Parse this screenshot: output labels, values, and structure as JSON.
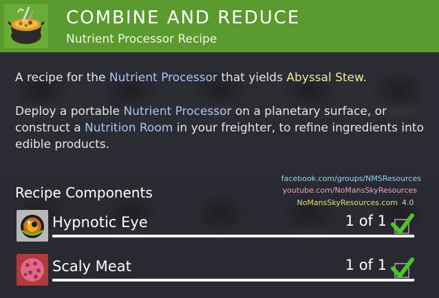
{
  "header": {
    "title": "COMBINE AND REDUCE",
    "subtitle": "Nutrient Processor Recipe"
  },
  "description": {
    "p1_a": "A recipe for the ",
    "p1_link": "Nutrient Processor",
    "p1_b": " that yields ",
    "p1_item": "Abyssal Stew",
    "p1_c": ".",
    "p2_a": "Deploy a portable ",
    "p2_link1": "Nutrient Processor",
    "p2_b": " on a planetary surface, or construct a ",
    "p2_link2": "Nutrition Room",
    "p2_c": " in your freighter, to refine ingredients into edible products."
  },
  "watermark": {
    "facebook": "facebook.com/groups/NMSResources",
    "youtube": "youtube.com/NoMansSkyResources",
    "site": "NoMansSkyResources.com",
    "version": "4.0"
  },
  "components_title": "Recipe Components",
  "components": [
    {
      "name": "Hypnotic Eye",
      "count": "1 of 1",
      "icon": "hypnotic-eye-icon"
    },
    {
      "name": "Scaly Meat",
      "count": "1 of 1",
      "icon": "scaly-meat-icon"
    }
  ],
  "colors": {
    "header_green": "#5a9a2e",
    "link_blue": "#a9c6f2",
    "item_yellow": "#f0eba0",
    "check_green": "#4fc22a"
  }
}
